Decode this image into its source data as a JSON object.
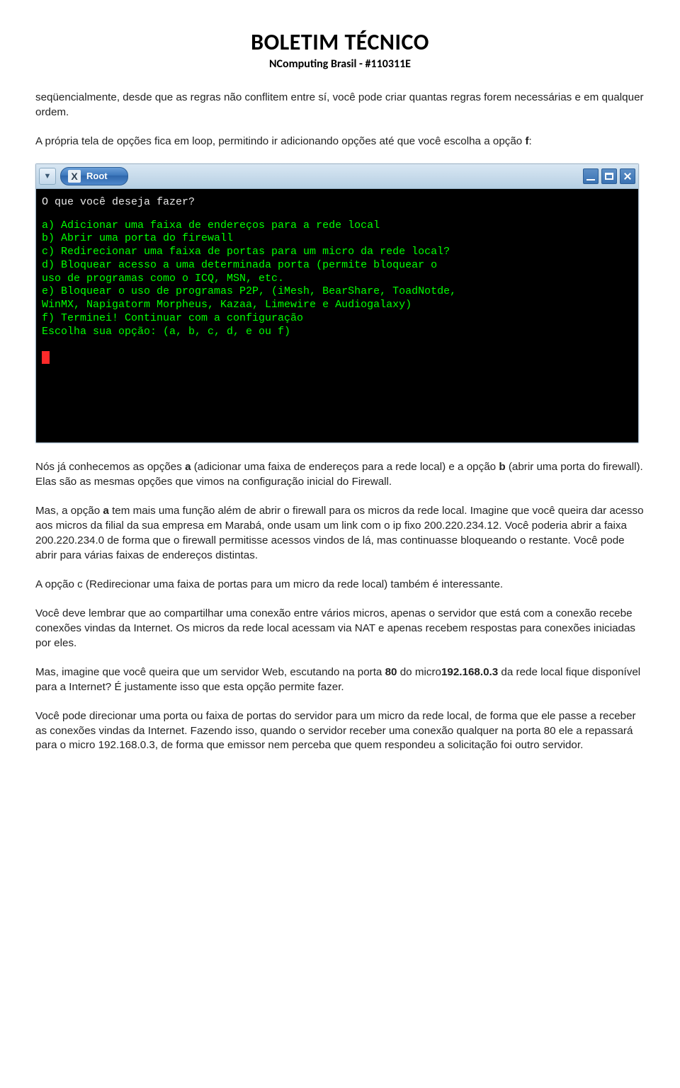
{
  "header": {
    "title": "BOLETIM TÉCNICO",
    "subtitle": "NComputing Brasil - #110311E"
  },
  "p1": "seqüencialmente, desde que as regras não conflitem entre sí, você pode criar quantas regras forem necessárias e em qualquer ordem.",
  "p2a": "A própria tela de opções fica em loop, permitindo ir adicionando opções até que você escolha a opção ",
  "p2b": "f",
  "p2c": ":",
  "window": {
    "root_label": "Root",
    "root_x": "X",
    "arrow": "▼"
  },
  "term": {
    "prompt": "O que você deseja fazer?",
    "a": "a) Adicionar uma faixa de endereços para a rede local",
    "b": "b) Abrir uma porta do firewall",
    "c": "c) Redirecionar uma faixa de portas para um micro da rede local?",
    "d1": "d) Bloquear acesso a uma determinada porta (permite bloquear o",
    "d2": "uso de programas como o ICQ, MSN, etc.",
    "e1": "e) Bloquear o uso de programas P2P, (iMesh, BearShare, ToadNotde,",
    "e2": "WinMX, Napigatorm Morpheus, Kazaa, Limewire e Audiogalaxy)",
    "f": "f) Terminei! Continuar com a configuração",
    "choose": "Escolha sua opção: (a, b, c, d, e ou f)"
  },
  "p3a": "Nós já conhecemos as opções ",
  "p3b": "a",
  "p3c": " (adicionar uma faixa de endereços para a rede local) e a opção ",
  "p3d": "b",
  "p3e": " (abrir uma porta do firewall). Elas são as mesmas opções que vimos na configuração inicial do Firewall.",
  "p4a": "Mas, a opção ",
  "p4b": "a",
  "p4c": " tem mais uma função além de abrir o firewall para os micros da rede local. Imagine que você queira dar acesso aos micros da filial da sua empresa em Marabá, onde usam um link com o ip fixo 200.220.234.12. Você poderia abrir a faixa 200.220.234.0 de forma que o firewall permitisse acessos vindos de lá, mas continuasse bloqueando o restante. Você pode abrir para várias faixas de endereços distintas.",
  "p5": "A opção c (Redirecionar uma faixa de portas para um micro da rede local) também é interessante.",
  "p6": "Você deve lembrar que ao compartilhar uma conexão entre vários micros, apenas o servidor que está com a conexão recebe conexões vindas da Internet. Os micros da rede local acessam via NAT e apenas recebem respostas para conexões iniciadas por eles.",
  "p7a": "Mas, imagine que você queira que um servidor Web, escutando na porta ",
  "p7b": "80",
  "p7c": " do micro",
  "p7d": "192.168.0.3",
  "p7e": " da rede local fique disponível para a Internet? É justamente isso que esta opção permite fazer.",
  "p8": "Você pode direcionar uma porta ou faixa de portas do servidor para um micro da rede local, de forma que ele passe a receber as conexões vindas da Internet. Fazendo isso, quando o servidor receber uma conexão qualquer na porta 80 ele a repassará para o micro 192.168.0.3, de forma que emissor nem perceba que quem respondeu a solicitação foi outro servidor."
}
